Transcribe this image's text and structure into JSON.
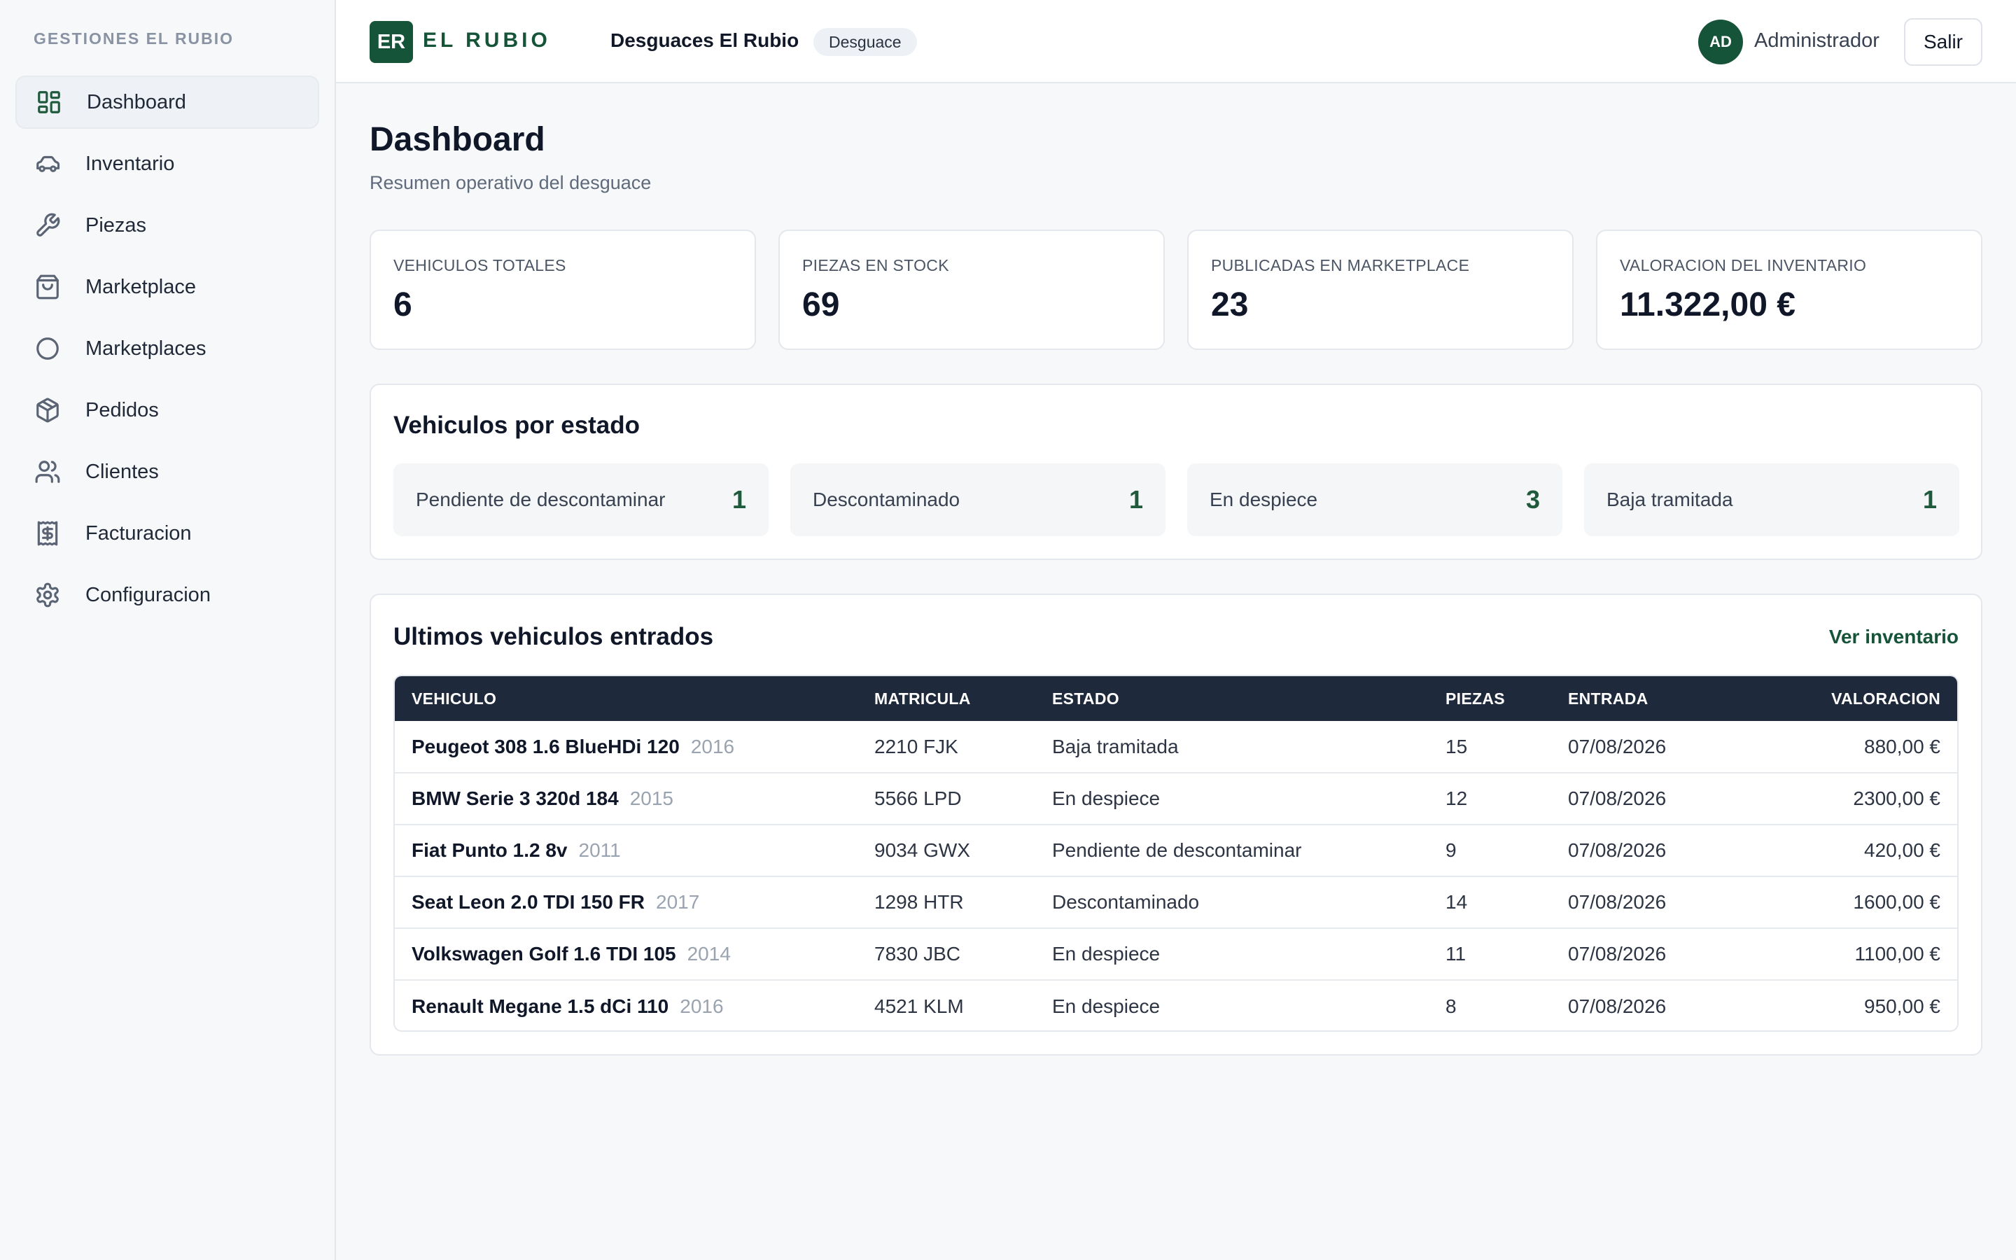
{
  "sidebar": {
    "brand": "GESTIONES EL RUBIO",
    "items": [
      {
        "label": "Dashboard",
        "icon": "dashboard-icon"
      },
      {
        "label": "Inventario",
        "icon": "car-icon"
      },
      {
        "label": "Piezas",
        "icon": "wrench-icon"
      },
      {
        "label": "Marketplace",
        "icon": "shopping-bag-icon"
      },
      {
        "label": "Marketplaces",
        "icon": "circle-icon"
      },
      {
        "label": "Pedidos",
        "icon": "package-icon"
      },
      {
        "label": "Clientes",
        "icon": "users-icon"
      },
      {
        "label": "Facturacion",
        "icon": "receipt-icon"
      },
      {
        "label": "Configuracion",
        "icon": "gear-icon"
      }
    ]
  },
  "header": {
    "logo_initials": "ER",
    "logo_text": "EL RUBIO",
    "company": "Desguaces El Rubio",
    "company_type": "Desguace",
    "user_initials": "AD",
    "user_name": "Administrador",
    "logout": "Salir"
  },
  "page": {
    "title": "Dashboard",
    "subtitle": "Resumen operativo del desguace"
  },
  "stats": [
    {
      "label": "VEHICULOS TOTALES",
      "value": "6"
    },
    {
      "label": "PIEZAS EN STOCK",
      "value": "69"
    },
    {
      "label": "PUBLICADAS EN MARKETPLACE",
      "value": "23"
    },
    {
      "label": "VALORACION DEL INVENTARIO",
      "value": "11.322,00 €"
    }
  ],
  "states": {
    "title": "Vehiculos por estado",
    "items": [
      {
        "label": "Pendiente de descontaminar",
        "count": "1"
      },
      {
        "label": "Descontaminado",
        "count": "1"
      },
      {
        "label": "En despiece",
        "count": "3"
      },
      {
        "label": "Baja tramitada",
        "count": "1"
      }
    ]
  },
  "recent": {
    "title": "Ultimos vehiculos entrados",
    "link": "Ver inventario",
    "columns": [
      "VEHICULO",
      "MATRICULA",
      "ESTADO",
      "PIEZAS",
      "ENTRADA",
      "VALORACION"
    ],
    "rows": [
      {
        "vehicle": "Peugeot 308 1.6 BlueHDi 120",
        "year": "2016",
        "plate": "2210 FJK",
        "status": "Baja tramitada",
        "parts": "15",
        "date": "07/08/2026",
        "value": "880,00 €"
      },
      {
        "vehicle": "BMW Serie 3 320d 184",
        "year": "2015",
        "plate": "5566 LPD",
        "status": "En despiece",
        "parts": "12",
        "date": "07/08/2026",
        "value": "2300,00 €"
      },
      {
        "vehicle": "Fiat Punto 1.2 8v",
        "year": "2011",
        "plate": "9034 GWX",
        "status": "Pendiente de descontaminar",
        "parts": "9",
        "date": "07/08/2026",
        "value": "420,00 €"
      },
      {
        "vehicle": "Seat Leon 2.0 TDI 150 FR",
        "year": "2017",
        "plate": "1298 HTR",
        "status": "Descontaminado",
        "parts": "14",
        "date": "07/08/2026",
        "value": "1600,00 €"
      },
      {
        "vehicle": "Volkswagen Golf 1.6 TDI 105",
        "year": "2014",
        "plate": "7830 JBC",
        "status": "En despiece",
        "parts": "11",
        "date": "07/08/2026",
        "value": "1100,00 €"
      },
      {
        "vehicle": "Renault Megane 1.5 dCi 110",
        "year": "2016",
        "plate": "4521 KLM",
        "status": "En despiece",
        "parts": "8",
        "date": "07/08/2026",
        "value": "950,00 €"
      }
    ]
  },
  "colors": {
    "brand": "#16543a",
    "table_header": "#1e293b",
    "background": "#f7f8fa"
  }
}
